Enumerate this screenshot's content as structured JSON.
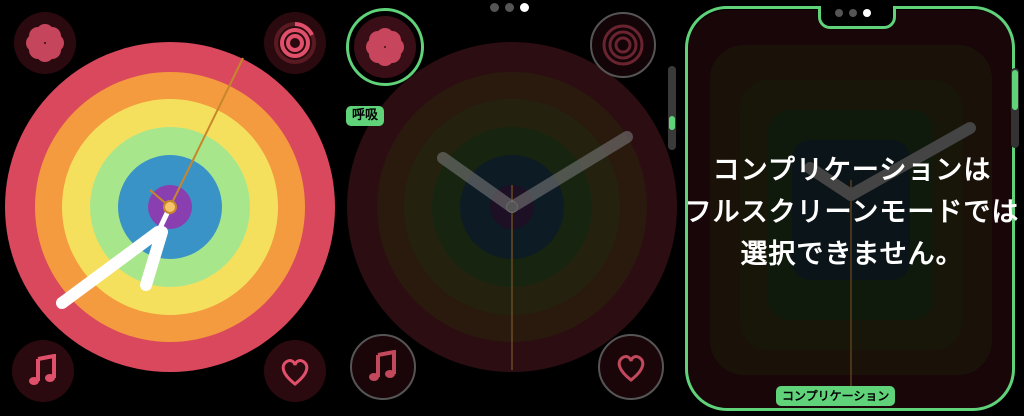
{
  "page_indicator": {
    "count": 3,
    "active": 2
  },
  "panel1": {
    "complications": [
      {
        "name": "breathe",
        "icon": "flower-icon"
      },
      {
        "name": "activity",
        "icon": "activity-rings-icon"
      },
      {
        "name": "music",
        "icon": "music-note-icon"
      },
      {
        "name": "heart-rate",
        "icon": "heart-icon"
      }
    ],
    "colors": [
      "#d9485c",
      "#f49a3f",
      "#f5e05e",
      "#a8e68c",
      "#3a93c6",
      "#8a3fb0"
    ]
  },
  "panel2": {
    "selected_complication_label": "呼吸",
    "accent": "#5fd27a"
  },
  "panel3": {
    "message_lines": [
      "コンプリケーションは",
      "フルスクリーンモードでは",
      "選択できません。"
    ],
    "bottom_label": "コンプリケーション",
    "accent": "#5fd27a"
  }
}
